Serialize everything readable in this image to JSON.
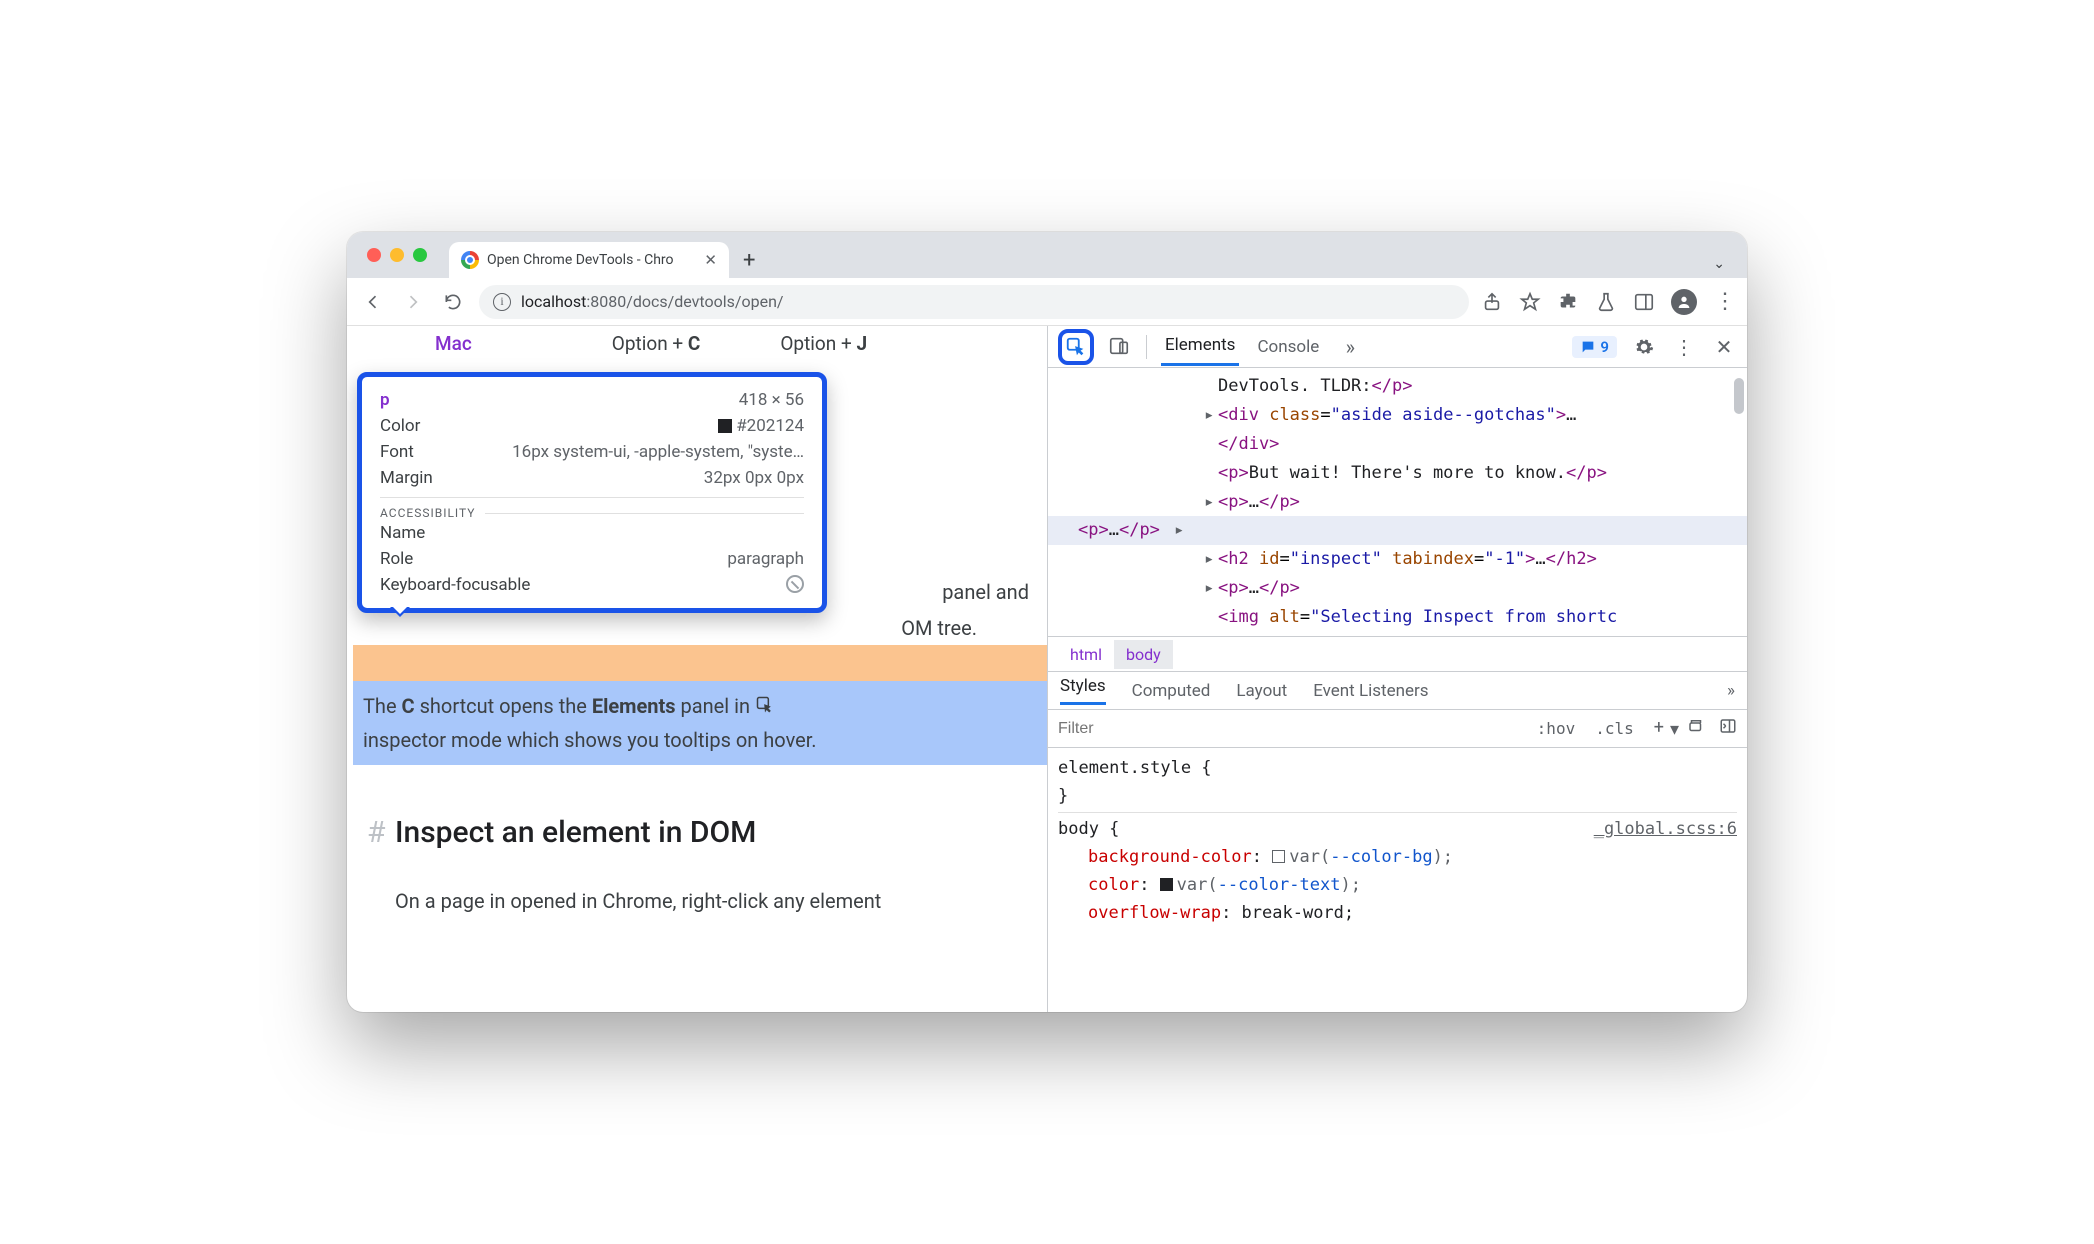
{
  "browser": {
    "tab_title": "Open Chrome DevTools - Chro",
    "url_host": "localhost",
    "url_port_path": ":8080/docs/devtools/open/"
  },
  "page": {
    "mac_label": "Mac",
    "option_c": "Option + ",
    "letter_c": "C",
    "option_j": "Option + ",
    "letter_j": "J",
    "line_partial_1": "panel and",
    "line_partial_2": "OM tree.",
    "p1_pre": "The ",
    "p1_c": "C",
    "p1_mid": " shortcut opens the ",
    "p1_el": "Elements",
    "p1_post": " panel in ",
    "p2": "inspector mode which shows you tooltips on hover.",
    "heading": "Inspect an element in DOM",
    "body_p": "On a page in opened in Chrome, right-click any element"
  },
  "tooltip": {
    "tag": "p",
    "size": "418 × 56",
    "color_label": "Color",
    "color_value": "#202124",
    "font_label": "Font",
    "font_value": "16px system-ui, -apple-system, \"syste…",
    "margin_label": "Margin",
    "margin_value": "32px 0px 0px",
    "a11y_heading": "ACCESSIBILITY",
    "name_label": "Name",
    "role_label": "Role",
    "role_value": "paragraph",
    "kf_label": "Keyboard-focusable"
  },
  "devtools": {
    "tabs": {
      "elements": "Elements",
      "console": "Console"
    },
    "issues_count": "9",
    "dom": {
      "l0_pre": "DevTools. TLDR:",
      "l1_open": "<div class=\"aside aside--gotchas\">",
      "l1_close": "</div>",
      "l2_open": "<p>",
      "l2_text": "But wait! There's more to know.",
      "l2_close": "</p>",
      "l3": "<p>…</p>",
      "l4": "<p>…</p>",
      "l5_open": "<h2 id=\"inspect\" tabindex=\"-1\">",
      "l5_mid": "…",
      "l5_close": "</h2>",
      "l6": "<p>…</p>",
      "l7": "<img alt=\"Selecting Inspect from shortc"
    },
    "crumbs": {
      "html": "html",
      "body": "body"
    },
    "styles_tabs": {
      "styles": "Styles",
      "computed": "Computed",
      "layout": "Layout",
      "event": "Event Listeners"
    },
    "filter_placeholder": "Filter",
    "hov": ":hov",
    "cls": ".cls",
    "pane": {
      "el_style_open": "element.style {",
      "brace_close": "}",
      "body_sel": "body {",
      "src": "_global.scss:6",
      "bgc": "background-color",
      "bgc_v_pre": "var(",
      "bgc_var": "--color-bg",
      "bgc_v_post": ");",
      "color": "color",
      "color_v_pre": "var(",
      "color_var": "--color-text",
      "color_v_post": ");",
      "ow": "overflow-wrap",
      "ow_v": "break-word;"
    }
  }
}
